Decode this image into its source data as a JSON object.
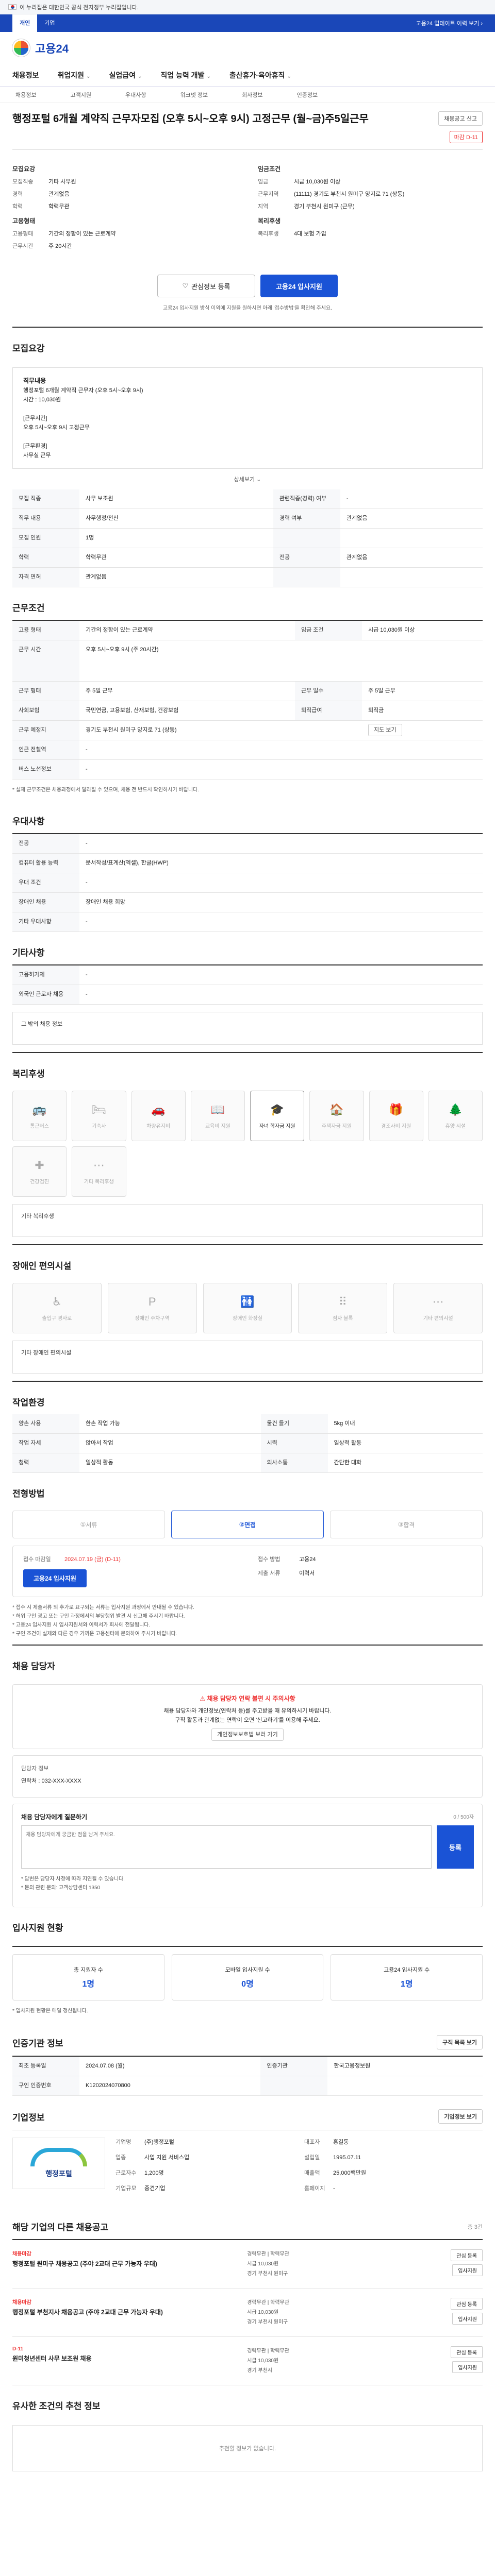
{
  "gov_banner": "이 누리집은 대한민국 공식 전자정부 누리집입니다.",
  "topbar": {
    "tabs": [
      "개인",
      "기업"
    ],
    "right": "고용24 업데이트 이력 보기 ›"
  },
  "brand": "고용24",
  "nav": {
    "items": [
      "채용정보",
      "취업지원",
      "실업급여",
      "직업 능력 개발",
      "출산휴가·육아휴직"
    ]
  },
  "subnav": {
    "items": [
      "채용정보",
      "고객지원",
      "우대사항",
      "워크넷 정보",
      "회사정보",
      "인증정보"
    ]
  },
  "job": {
    "title": "행정포털 6개월 계약직 근무자모집 (오후 5시~오후 9시) 고정근무 (월~금)주5일근무",
    "deadline_badge": "마감 D-11",
    "report_btn": "채용공고 신고",
    "meta_left_title": "모집요강",
    "meta": [
      {
        "k": "모집직종",
        "v": "기타 사무원"
      },
      {
        "k": "경력",
        "v": "관계없음"
      },
      {
        "k": "학력",
        "v": "학력무관"
      }
    ],
    "meta_right_title": "임금조건",
    "meta_right": [
      {
        "k": "임금",
        "v": "시급 10,030원 이상"
      },
      {
        "k": "근무지역",
        "v": "(11111) 경기도 부천시 원미구 양지로 71 (상동)"
      },
      {
        "k": "지역",
        "v": "경기 부천시 원미구 (근무)"
      }
    ],
    "meta_extra_left_title": "고용형태",
    "meta_extra_left": [
      {
        "k": "고용형태",
        "v": "기간의 정함이 있는 근로계약"
      },
      {
        "k": "근무시간",
        "v": "주 20시간"
      }
    ],
    "meta_extra_right_title": "복리후생",
    "meta_extra_right": [
      {
        "k": "복리후생",
        "v": "4대 보험 가입"
      }
    ]
  },
  "actions": {
    "scrap": "관심정보 등록",
    "apply": "고용24 입사지원"
  },
  "note_text": "고용24 입사지원 방식 이외에 지원을 원하시면 아래 '접수방법'을 확인해 주세요.",
  "summary": {
    "title": "모집요강",
    "box_title": "직무내용",
    "lines": [
      "행정포털 6개월 계약직 근무자 (오후 5시~오후 9시)",
      "시간 : 10,030원",
      "",
      "[근무시간]",
      "오후 5시~오후 9시 고정근무",
      "",
      "[근무환경]",
      "사무실 근무"
    ],
    "more": "상세보기 ⌄"
  },
  "recruit_rows": [
    {
      "k": "모집 직종",
      "v": "사무 보조원",
      "k2": "관련직종(경력) 여부",
      "v2": "-"
    },
    {
      "k": "직무 내용",
      "v": "사무행정/전산",
      "k2": "경력 여부",
      "v2": "관계없음"
    },
    {
      "k": "모집 인원",
      "v": "1명",
      "k2": "",
      "v2": ""
    },
    {
      "k": "학력",
      "v": "학력무관",
      "k2": "전공",
      "v2": "관계없음"
    },
    {
      "k": "자격 면허",
      "v": "관계없음",
      "k2": "",
      "v2": ""
    }
  ],
  "work_cond": {
    "title": "근무조건",
    "rows": [
      {
        "k": "고용 형태",
        "v": "기간의 정함이 있는 근로계약",
        "k2": "임금 조건",
        "v2": "시급 10,030원 이상"
      },
      {
        "k": "근무 시간",
        "v": "오후 5시~오후 9시 (주 20시간)",
        "k2": "",
        "v2": ""
      },
      {
        "k": "근무 형태",
        "v": "주 5일 근무",
        "k2": "근무 일수",
        "v2": "주 5일 근무"
      },
      {
        "k": "사회보험",
        "v": "국민연금, 고용보험, 산재보험, 건강보험",
        "k2": "퇴직급여",
        "v2": "퇴직금"
      },
      {
        "k": "근무 예정지",
        "v": "경기도 부천시 원미구 양지로 71 (상동)",
        "k2": "",
        "v2": "지도 보기"
      },
      {
        "k": "인근 전철역",
        "v": "-",
        "k2": "",
        "v2": ""
      },
      {
        "k": "버스 노선정보",
        "v": "-",
        "k2": "",
        "v2": ""
      }
    ],
    "footnote": "* 실제 근무조건은 채용과정에서 달라질 수 있으며, 채용 전 반드시 확인하시기 바랍니다."
  },
  "prefs": {
    "title": "우대사항",
    "rows": [
      {
        "k": "전공",
        "v": "-"
      },
      {
        "k": "컴퓨터 활용 능력",
        "v": "문서작성/표계산(엑셀), 한글(HWP)"
      },
      {
        "k": "우대 조건",
        "v": "-"
      },
      {
        "k": "장애인 채용",
        "v": "장애인 채용 희망"
      },
      {
        "k": "기타 우대사항",
        "v": "-"
      }
    ]
  },
  "etc": {
    "title": "기타사항",
    "rows": [
      {
        "k": "고용허가제",
        "v": "-"
      },
      {
        "k": "외국인 근로자 채용",
        "v": "-"
      }
    ],
    "box": "그 밖의 채용 정보"
  },
  "welfare": {
    "title": "복리후생",
    "items": [
      "통근버스",
      "기숙사",
      "차량유지비",
      "교육비 지원",
      "자녀 학자금 지원",
      "주택자금 지원",
      "경조사비 지원",
      "휴양 시설",
      "건강검진",
      "기타 복리후생"
    ],
    "active_index": 4,
    "box_label": "기타 복리후생"
  },
  "disabled": {
    "title": "장애인 편의시설",
    "items": [
      "출입구 경사로",
      "장애인 주차구역",
      "장애인 화장실",
      "점자 블록",
      "기타 편의시설"
    ],
    "box_label": "기타 장애인 편의시설"
  },
  "env": {
    "title": "작업환경",
    "rows": [
      {
        "k": "양손 사용",
        "v": "한손 작업 가능",
        "k2": "물건 들기",
        "v2": "5kg 이내"
      },
      {
        "k": "작업 자세",
        "v": "앉아서 작업",
        "k2": "시력",
        "v2": "일상적 활동"
      },
      {
        "k": "청력",
        "v": "일상적 활동",
        "k2": "의사소통",
        "v2": "간단한 대화"
      }
    ]
  },
  "process": {
    "title": "전형방법",
    "steps": [
      "서류",
      "면접",
      "합격"
    ],
    "active": 1,
    "apply_left": [
      {
        "k": "접수 마감일",
        "v": "2024.07.19 (금) (D-11)"
      },
      {
        "k": "",
        "v": ""
      }
    ],
    "apply_right": [
      {
        "k": "접수 방법",
        "v": "고용24"
      },
      {
        "k": "제출 서류",
        "v": "이력서"
      }
    ],
    "apply_btn": "고용24 입사지원",
    "bullets": [
      "* 접수 시 제출서류 외 추가로 요구되는 서류는 입사지원 과정에서 안내될 수 있습니다.",
      "* 허위 구인 광고 또는 구인 과정에서의 부당행위 발견 시 신고해 주시기 바랍니다.",
      "* 고용24 입사지원 시 입사지원서와 이력서가 회사에 전달됩니다.",
      "* 구인 조건이 실제와 다른 경우 가까운 고용센터에 문의하여 주시기 바랍니다."
    ]
  },
  "manager": {
    "title": "채용 담당자",
    "ttl": "채용 담당자 연락 불편 시 주의사항",
    "body": [
      "채용 담당자와 개인정보(연락처 등)를 주고받을 때 유의하시기 바랍니다.",
      "구직 활동과 관계없는 연락이 오면 '신고하기'를 이용해 주세요."
    ],
    "btn": "개인정보보호법 보러 가기",
    "contact_name": "담당자 정보",
    "contact_phone": "연락처 : 032-XXX-XXXX",
    "inquiry_title": "채용 담당자에게 질문하기",
    "inquiry_count": "0 / 500자",
    "placeholder": "채용 담당자에게 궁금한 점을 남겨 주세요.",
    "send": "등록",
    "foot": [
      "* 답변은 담당자 사정에 따라 지연될 수 있습니다.",
      "* 문의 관련 문의: 고객상담센터 1350"
    ]
  },
  "stats": {
    "title": "입사지원 현황",
    "items": [
      {
        "k": "총 지원자 수",
        "v": "1명"
      },
      {
        "k": "모바일 입사지원 수",
        "v": "0명"
      },
      {
        "k": "고용24 입사지원 수",
        "v": "1명"
      }
    ],
    "note": "* 입사지원 현황은 매일 갱신됩니다."
  },
  "info": {
    "title": "인증기관 정보",
    "btn": "구직 목록 보기",
    "rows": [
      {
        "k": "최초 등록일",
        "v": "2024.07.08 (월)",
        "k2": "인증기관",
        "v2": "한국고용정보원"
      },
      {
        "k": "구인 인증번호",
        "v": "K1202024070800",
        "k2": "",
        "v2": ""
      }
    ]
  },
  "company": {
    "title": "기업정보",
    "btn": "기업정보 보기",
    "name": "행정포털",
    "rows": [
      {
        "k": "기업명",
        "v": "(주)행정포털"
      },
      {
        "k": "대표자",
        "v": "홍길동"
      },
      {
        "k": "업종",
        "v": "사업 지원 서비스업"
      },
      {
        "k": "설립일",
        "v": "1995.07.11"
      },
      {
        "k": "근로자수",
        "v": "1,200명"
      },
      {
        "k": "매출액",
        "v": "25,000백만원"
      },
      {
        "k": "기업규모",
        "v": "중견기업"
      },
      {
        "k": "홈페이지",
        "v": "-"
      }
    ]
  },
  "others": {
    "title": "해당 기업의 다른 채용공고",
    "right": "총 3건",
    "items": [
      {
        "tag": "채용마감",
        "title": "행정포털 원미구 채용공고 (주야 2교대 근무 가능자 우대)",
        "mid": [
          "경력무관 | 학력무관",
          "시급 10,030원",
          "경기 부천시 원미구"
        ],
        "r": [
          "관심 등록",
          "입사지원"
        ]
      },
      {
        "tag": "채용마감",
        "title": "행정포털 부천지사 채용공고 (주야 2교대 근무 가능자 우대)",
        "mid": [
          "경력무관 | 학력무관",
          "시급 10,030원",
          "경기 부천시 원미구"
        ],
        "r": [
          "관심 등록",
          "입사지원"
        ]
      },
      {
        "tag": "D-11",
        "title": "원미청년센터 사무 보조원 채용",
        "mid": [
          "경력무관 | 학력무관",
          "시급 10,030원",
          "경기 부천시"
        ],
        "r": [
          "관심 등록",
          "입사지원"
        ]
      }
    ]
  },
  "similar": {
    "title": "유사한 조건의 추천 정보",
    "empty": "추천할 정보가 없습니다."
  }
}
